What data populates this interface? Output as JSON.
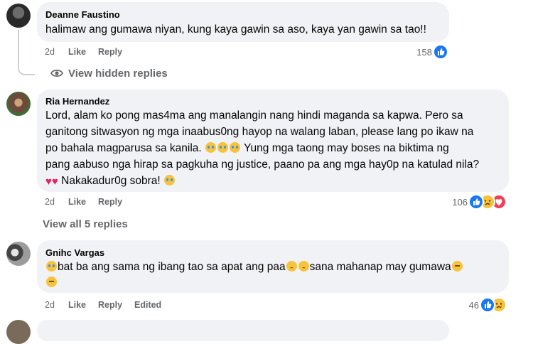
{
  "comments": [
    {
      "author": "Deanne Faustino",
      "text_lines": [
        "halimaw ang gumawa niyan, kung kaya gawin sa aso, kaya yan gawin sa tao!!"
      ],
      "time": "2d",
      "like_label": "Like",
      "reply_label": "Reply",
      "reaction_count": "158",
      "reactions": [
        "like"
      ]
    },
    {
      "author": "Ria Hernandez",
      "text_lines": [
        "Lord, alam ko pong mas4ma ang manalangin nang hindi maganda sa kapwa. Pero sa",
        "ganitong sitwasyon ng mga inaabus0ng hayop na walang laban, please lang po ikaw na",
        "po bahala magparusa sa kanila.",
        "Yung mga taong may boses na biktima ng",
        "pang aabuso nga hirap sa pagkuha ng justice, paano pa ang mga hay0p na katulad nila?",
        "Nakakadur0g sobra!"
      ],
      "time": "2d",
      "like_label": "Like",
      "reply_label": "Reply",
      "reaction_count": "106",
      "reactions": [
        "like",
        "sad",
        "love"
      ]
    },
    {
      "author": "Gnihc Vargas",
      "text_lines": [
        "bat ba ang sama ng ibang tao sa apat ang paa",
        "sana mahanap may gumawa"
      ],
      "time": "2d",
      "like_label": "Like",
      "reply_label": "Reply",
      "edited_label": "Edited",
      "reaction_count": "46",
      "reactions": [
        "like",
        "sad"
      ]
    }
  ],
  "view_hidden_replies": "View hidden replies",
  "view_all_replies": "View all 5 replies",
  "colors": {
    "bubble": "#f0f2f5",
    "meta_text": "#65676b",
    "like_blue": "#1877f2",
    "love_red": "#f33e58",
    "sad_yellow": "#f7c33b"
  },
  "icons": [
    "eye-icon",
    "like-reaction-icon",
    "sad-reaction-icon",
    "love-reaction-icon",
    "crying-emoji",
    "broken-heart-emoji",
    "sad-emoji",
    "sleepy-emoji"
  ]
}
